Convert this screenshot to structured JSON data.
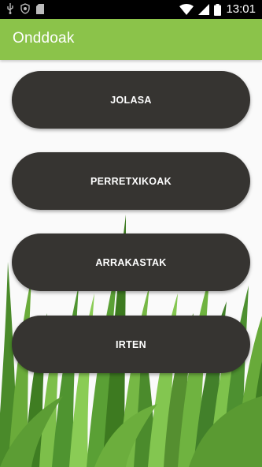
{
  "status_bar": {
    "time": "13:01",
    "icons": [
      "usb-icon",
      "shield-icon",
      "sd-card-icon",
      "wifi-icon",
      "signal-icon",
      "battery-icon"
    ]
  },
  "app_bar": {
    "title": "Onddoak",
    "color": "#8bc34a"
  },
  "menu": {
    "buttons": [
      {
        "label": "JOLASA"
      },
      {
        "label": "PERRETXIKOAK"
      },
      {
        "label": "ARRAKASTAK"
      },
      {
        "label": "IRTEN"
      }
    ],
    "button_color": "#363431"
  }
}
